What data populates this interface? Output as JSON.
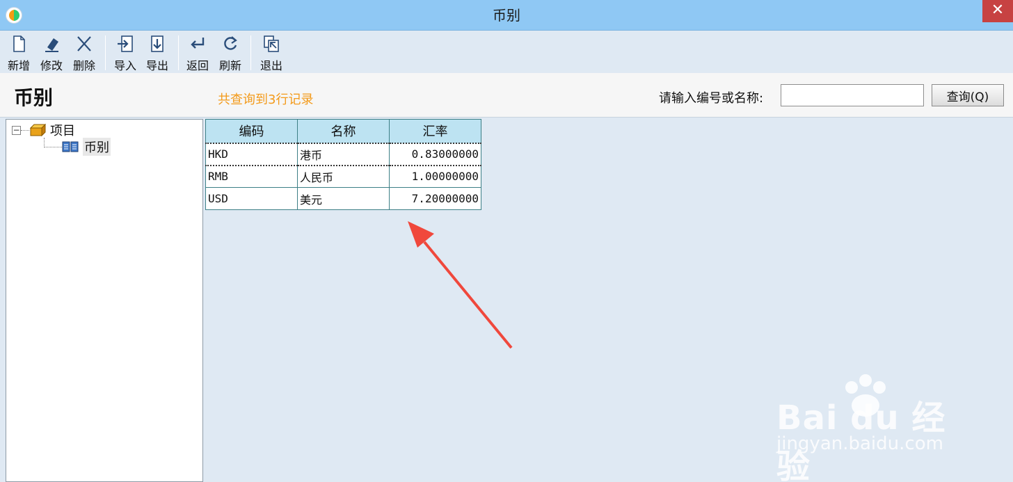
{
  "window": {
    "title": "币别",
    "close_glyph": "✕"
  },
  "toolbar": {
    "buttons": [
      {
        "label": "新增",
        "icon": "new-document-icon"
      },
      {
        "label": "修改",
        "icon": "eraser-icon"
      },
      {
        "label": "删除",
        "icon": "delete-x-icon"
      },
      {
        "label": "导入",
        "icon": "import-icon"
      },
      {
        "label": "导出",
        "icon": "export-icon"
      },
      {
        "label": "返回",
        "icon": "return-icon"
      },
      {
        "label": "刷新",
        "icon": "refresh-icon"
      },
      {
        "label": "退出",
        "icon": "exit-icon"
      }
    ]
  },
  "header": {
    "page_title": "币别",
    "record_count": "共查询到3行记录",
    "search_label": "请输入编号或名称:",
    "search_value": "",
    "query_button": "查询(Q)"
  },
  "tree": {
    "root": {
      "label": "项目",
      "expander": "⊟"
    },
    "child": {
      "label": "币别"
    }
  },
  "grid": {
    "columns": [
      "编码",
      "名称",
      "汇率"
    ],
    "rows": [
      {
        "code": "HKD",
        "name": "港币",
        "rate": "0.83000000"
      },
      {
        "code": "RMB",
        "name": "人民币",
        "rate": "1.00000000"
      },
      {
        "code": "USD",
        "name": "美元",
        "rate": "7.20000000"
      }
    ]
  },
  "watermark": {
    "brand": "Bai du 经验",
    "url": "jingyan.baidu.com"
  },
  "colors": {
    "titlebar": "#8fc8f4",
    "accent_orange": "#f39a1a",
    "grid_header": "#bde3f2",
    "arrow_red": "#f0483c"
  }
}
